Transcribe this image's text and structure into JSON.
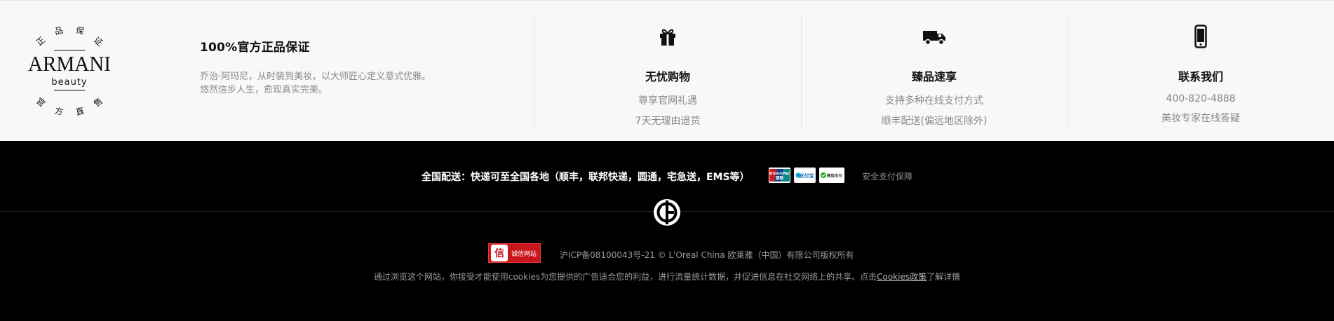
{
  "brand_seal": {
    "top_chars": [
      "正",
      "品",
      "保",
      "证"
    ],
    "bottom_chars": [
      "官",
      "方",
      "直",
      "售"
    ],
    "wordmark": "ARMANI",
    "sub": "beauty"
  },
  "guarantee": {
    "title": "100%官方正品保证",
    "line1": "乔治·阿玛尼，从时装到美妆，以大师匠心定义意式优雅。",
    "line2": "悠然信步人生，愈现真实完美。"
  },
  "features": [
    {
      "icon": "gift-icon",
      "title": "无忧购物",
      "line1": "尊享官网礼遇",
      "line2": "7天无理由退货"
    },
    {
      "icon": "truck-icon",
      "title": "臻品速享",
      "line1": "支持多种在线支付方式",
      "line2": "顺丰配送(偏远地区除外)"
    },
    {
      "icon": "phone-icon",
      "title": "联系我们",
      "line1": "400-820-4888",
      "line2": "美妆专家在线答疑"
    }
  ],
  "shipping": {
    "text": "全国配送：快递可至全国各地（顺丰，联邦快递，圆通，宅急送，EMS等）",
    "payments": [
      {
        "name": "unionpay-icon",
        "label": "UnionPay 银联"
      },
      {
        "name": "alipay-icon",
        "label": "支付宝"
      },
      {
        "name": "wechatpay-icon",
        "label": "微信支付"
      }
    ],
    "secure_label": "安全支付保障"
  },
  "credit_badge": {
    "glyph": "信",
    "text": "诚信网站"
  },
  "icp_text": "沪ICP备08100043号-21 © L'Oreal China 欧莱雅（中国）有限公司版权所有",
  "cookie": {
    "prefix": "通过浏览这个网站，你接受才能使用cookies为您提供的广告适合您的利益，进行流量统计数据，并促进信息在社交网络上的共享。点击",
    "link": "Cookies政策",
    "suffix": "了解详情"
  },
  "colors": {
    "top_bg": "#f8f8f8",
    "bottom_bg": "#000000",
    "badge_red": "#c8161d"
  }
}
